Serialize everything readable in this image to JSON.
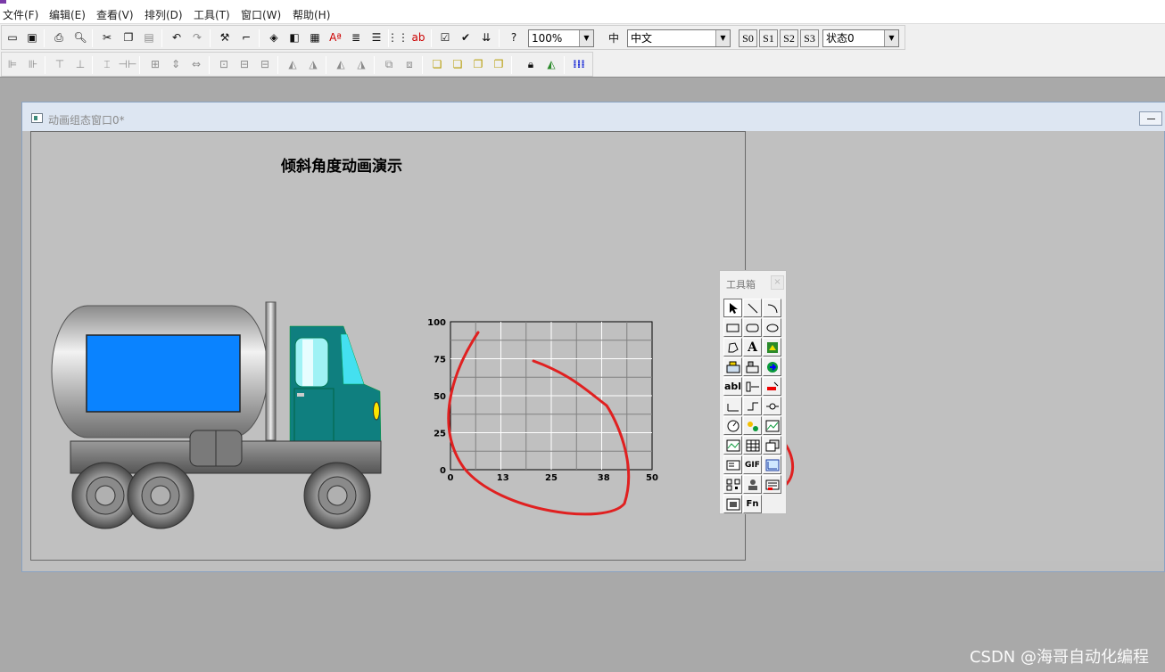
{
  "menubar": {
    "items": [
      "文件(F)",
      "编辑(E)",
      "查看(V)",
      "排列(D)",
      "工具(T)",
      "窗口(W)",
      "帮助(H)"
    ]
  },
  "toolbar": {
    "zoom_value": "100%",
    "language_value": "中文",
    "state_buttons": [
      "S0",
      "S1",
      "S2",
      "S3"
    ],
    "state_value": "状态0"
  },
  "child_window": {
    "title": "动画组态窗口0*"
  },
  "canvas": {
    "title": "倾斜角度动画演示"
  },
  "chart_data": {
    "type": "line",
    "x_ticks": [
      "0",
      "13",
      "25",
      "38",
      "50"
    ],
    "y_ticks": [
      "100",
      "75",
      "50",
      "25",
      "0"
    ],
    "xlim": [
      0,
      50
    ],
    "ylim": [
      0,
      100
    ],
    "grid": true,
    "series": []
  },
  "toolbox": {
    "title": "工具箱",
    "close_label": "×",
    "text_tool_label": "A",
    "input_tool_label": "abl",
    "gif_tool_label": "GIF",
    "fn_tool_label": "Fn"
  },
  "watermark": "CSDN @海哥自动化编程",
  "colors": {
    "canvas_bg": "#c0c0c0",
    "tank_window": "#0a83ff",
    "cab_teal": "#0f7f7f",
    "annotation_red": "#e02020"
  }
}
